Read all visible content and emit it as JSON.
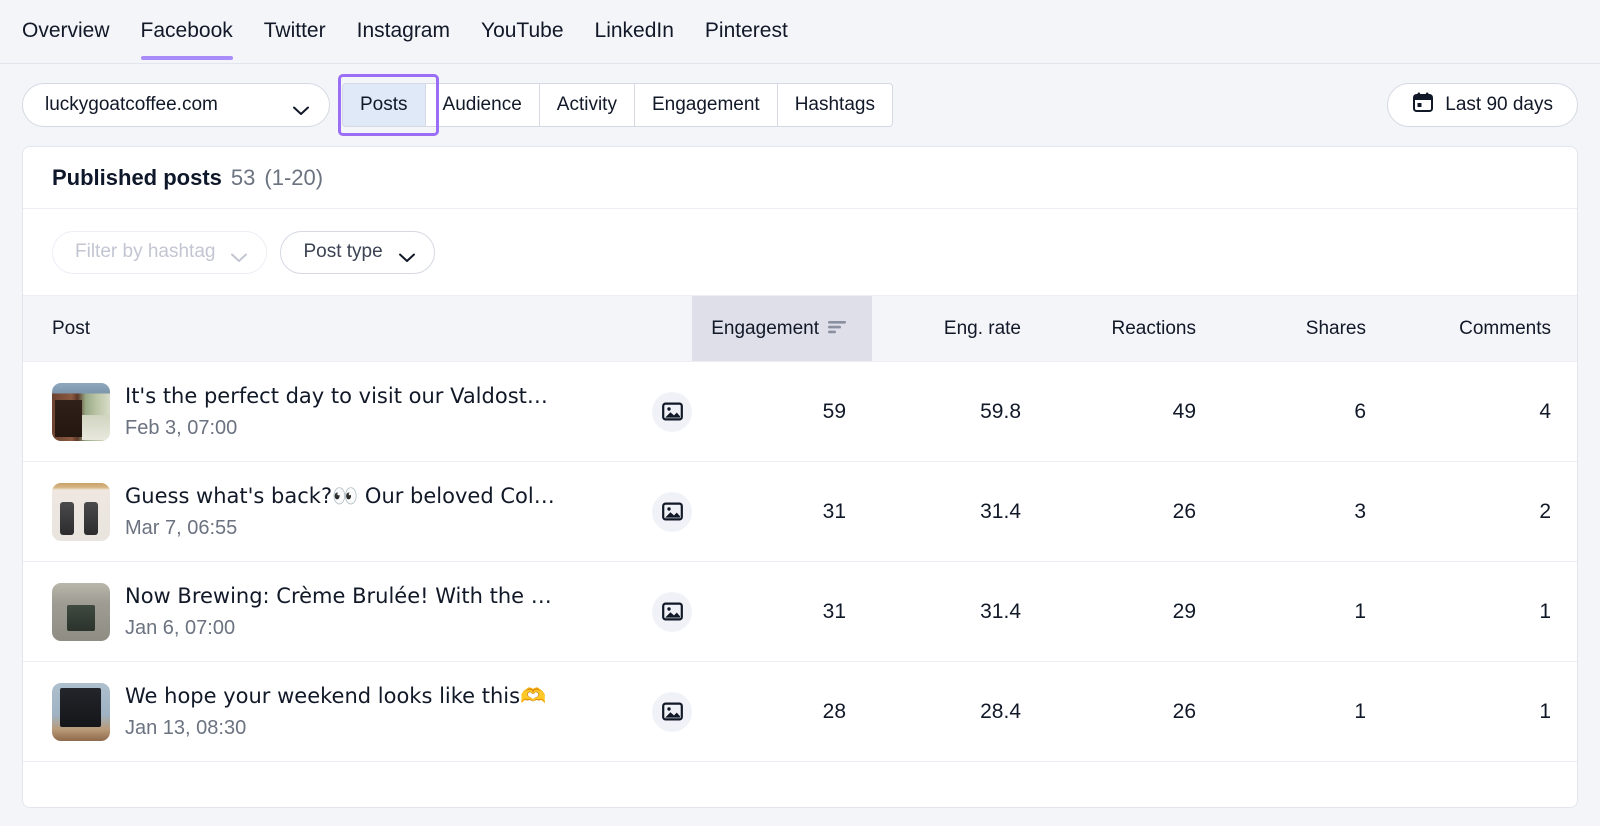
{
  "network_tabs": [
    {
      "label": "Overview",
      "active": false
    },
    {
      "label": "Facebook",
      "active": true
    },
    {
      "label": "Twitter",
      "active": false
    },
    {
      "label": "Instagram",
      "active": false
    },
    {
      "label": "YouTube",
      "active": false
    },
    {
      "label": "LinkedIn",
      "active": false
    },
    {
      "label": "Pinterest",
      "active": false
    }
  ],
  "controls": {
    "domain_value": "luckygoatcoffee.com",
    "segments": [
      {
        "label": "Posts",
        "active": true,
        "highlighted": true
      },
      {
        "label": "Audience",
        "active": false
      },
      {
        "label": "Activity",
        "active": false
      },
      {
        "label": "Engagement",
        "active": false
      },
      {
        "label": "Hashtags",
        "active": false
      }
    ],
    "date_range": "Last 90 days",
    "calendar_icon": "calendar-icon",
    "chevron_icon": "chevron-down-icon",
    "highlight_color": "#9a6ef5",
    "active_tab_underline_color": "#a98bfa"
  },
  "card": {
    "title": "Published posts",
    "count": "53",
    "range": "(1-20)",
    "filters": [
      {
        "label": "Filter by hashtag",
        "muted": true,
        "name": "hashtag-filter"
      },
      {
        "label": "Post type",
        "muted": false,
        "name": "post-type-filter"
      }
    ]
  },
  "table": {
    "columns": [
      {
        "label": "Post",
        "align": "left",
        "sorted": false
      },
      {
        "label": "Engagement",
        "align": "right",
        "sorted": true,
        "sort_dir": "desc"
      },
      {
        "label": "Eng. rate",
        "align": "right",
        "sorted": false
      },
      {
        "label": "Reactions",
        "align": "right",
        "sorted": false
      },
      {
        "label": "Shares",
        "align": "right",
        "sorted": false
      },
      {
        "label": "Comments",
        "align": "right",
        "sorted": false
      }
    ],
    "rows": [
      {
        "title": "It's the perfect day to visit our Valdosta ...",
        "date": "Feb 3, 07:00",
        "type_icon": "image-icon",
        "thumb": "storefront-photo",
        "engagement": "59",
        "eng_rate": "59.8",
        "reactions": "49",
        "shares": "6",
        "comments": "4"
      },
      {
        "title": "Guess what's back?👀 Our beloved Cold ...",
        "date": "Mar 7, 06:55",
        "type_icon": "image-icon",
        "thumb": "cooler-cans-photo",
        "engagement": "31",
        "eng_rate": "31.4",
        "reactions": "26",
        "shares": "3",
        "comments": "2"
      },
      {
        "title": "Now Brewing: Crème Brulée! With the p...",
        "date": "Jan 6, 07:00",
        "type_icon": "image-icon",
        "thumb": "coffee-bag-photo",
        "engagement": "31",
        "eng_rate": "31.4",
        "reactions": "29",
        "shares": "1",
        "comments": "1"
      },
      {
        "title": "We hope your weekend looks like this🫶",
        "date": "Jan 13, 08:30",
        "type_icon": "image-icon",
        "thumb": "chalkboard-sign-photo",
        "engagement": "28",
        "eng_rate": "28.4",
        "reactions": "26",
        "shares": "1",
        "comments": "1"
      }
    ]
  }
}
